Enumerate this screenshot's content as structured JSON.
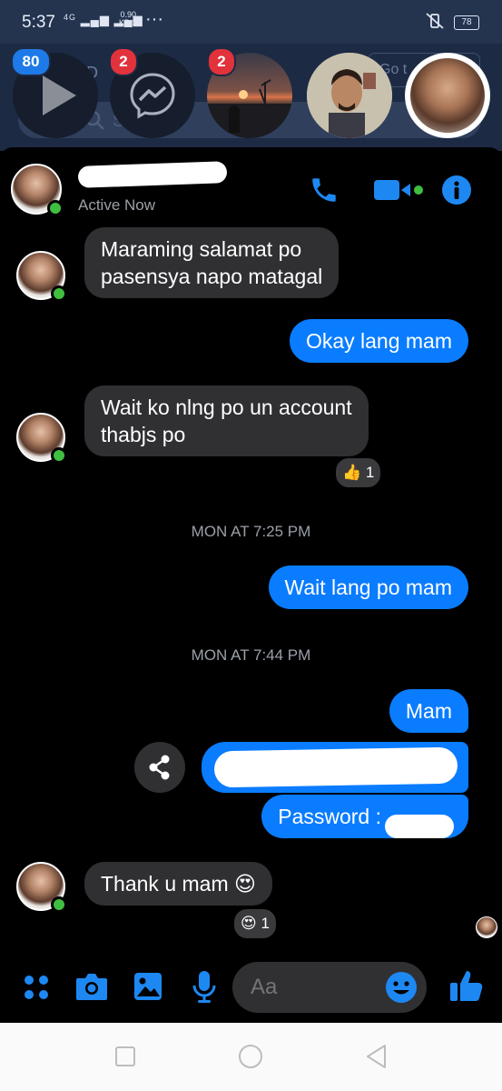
{
  "status_bar": {
    "time": "5:37",
    "signal": "4G",
    "net_speed_value": "0.90",
    "net_speed_unit": "KB/S",
    "more": "···",
    "battery": "78"
  },
  "background_app": {
    "search_placeholder": "Search",
    "goto_label": "Go t",
    "partial_text": "D"
  },
  "chat_heads": {
    "video_badge": "80",
    "messenger_badge": "2",
    "sunset_badge": "2"
  },
  "header": {
    "status": "Active Now"
  },
  "messages": {
    "m1": "Maraming salamat po\npasensya napo matagal",
    "m2": "Okay lang mam",
    "m3": "Wait ko nlng po un account\nthabjs po",
    "m3_reaction_emoji": "👍",
    "m3_reaction_count": "1",
    "ts1": "MON AT 7:25 PM",
    "m4": "Wait lang po mam",
    "ts2": "MON AT 7:44 PM",
    "m5": "Mam",
    "m7": "Password :",
    "m8": "Thank u mam",
    "m8_emoji": "😍",
    "m8_reaction_emoji": "😍",
    "m8_reaction_count": "1"
  },
  "composer": {
    "placeholder": "Aa"
  },
  "colors": {
    "accent": "#0a7cff",
    "incoming_bubble": "#303033",
    "online": "#3fbf3f",
    "badge": "#e2323c"
  }
}
